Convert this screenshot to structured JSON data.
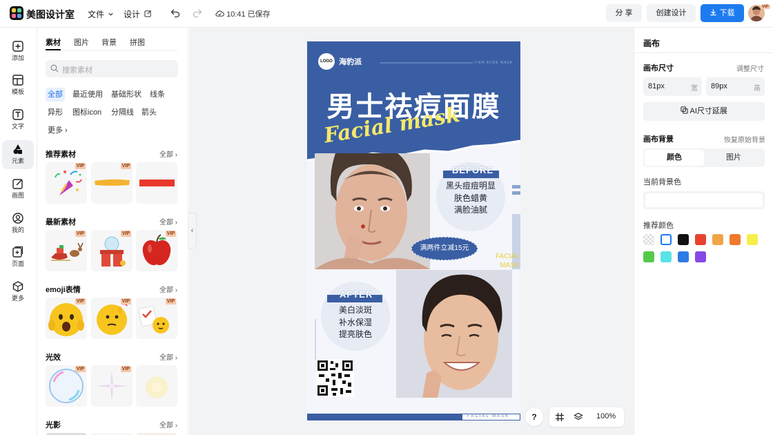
{
  "app": {
    "name": "美图设计室"
  },
  "header": {
    "file_menu": "文件",
    "design_menu": "设计",
    "save_status": "10:41 已保存",
    "share_label": "分 享",
    "create_label": "创建设计",
    "download_label": "下载",
    "avatar_badge": "VIP"
  },
  "rail": {
    "items": [
      {
        "label": "添加",
        "icon": "plus-square-icon"
      },
      {
        "label": "模板",
        "icon": "template-icon"
      },
      {
        "label": "文字",
        "icon": "text-icon"
      },
      {
        "label": "元素",
        "icon": "shapes-icon"
      },
      {
        "label": "画图",
        "icon": "draw-icon"
      },
      {
        "label": "我的",
        "icon": "user-icon"
      },
      {
        "label": "页面",
        "icon": "page-add-icon"
      },
      {
        "label": "更多",
        "icon": "cube-icon"
      }
    ]
  },
  "panel": {
    "tabs": [
      "素材",
      "图片",
      "背景",
      "拼图"
    ],
    "search_placeholder": "搜索素材",
    "chips": [
      "全部",
      "最近使用",
      "基础形状",
      "线条",
      "异形",
      "图标icon",
      "分隔线",
      "箭头",
      "更多"
    ],
    "vip": "VIP",
    "all_label": "全部",
    "sections": [
      "推荐素材",
      "最新素材",
      "emoji表情",
      "光效",
      "光影"
    ]
  },
  "poster": {
    "logo": "LOGO",
    "brand": "海豹派",
    "slogan": "VIEN ACNE MASK",
    "title": "男士祛痘面膜",
    "script": "Facial mask",
    "before_label": "BEFORE",
    "before_lines": [
      "黑头痘痘明显",
      "肤色蜡黄",
      "满脸油腻"
    ],
    "promo": "满两件立减15元",
    "facial_lines": [
      "FACIAL",
      "MASK"
    ],
    "after_label": "AFTER",
    "after_lines": [
      "美白淡斑",
      "补水保湿",
      "提亮肤色"
    ],
    "footer_text": "FACIAL MASK"
  },
  "zoom": {
    "help": "?",
    "level": "100%"
  },
  "right": {
    "title": "画布",
    "size_title": "画布尺寸",
    "size_action": "调整尺寸",
    "width_value": "81px",
    "width_unit": "宽",
    "height_value": "89px",
    "height_unit": "高",
    "ai_button": "AI尺寸延展",
    "bg_title": "画布背景",
    "bg_reset": "恢复原始背景",
    "bg_tab_color": "颜色",
    "bg_tab_image": "图片",
    "current_bg": "当前背景色",
    "recommend": "推荐颜色",
    "swatches": [
      "transparent",
      "#ffffff",
      "#111111",
      "#e8432f",
      "#f2a447",
      "#ee7a2a",
      "#f5ef4a",
      "#55c94a",
      "#59e3e8",
      "#2f7be5",
      "#8749e6"
    ]
  },
  "colors": {
    "accent": "#1d7bf0",
    "poster_blue": "#3a5ea3",
    "poster_yellow": "#f3e86a"
  }
}
